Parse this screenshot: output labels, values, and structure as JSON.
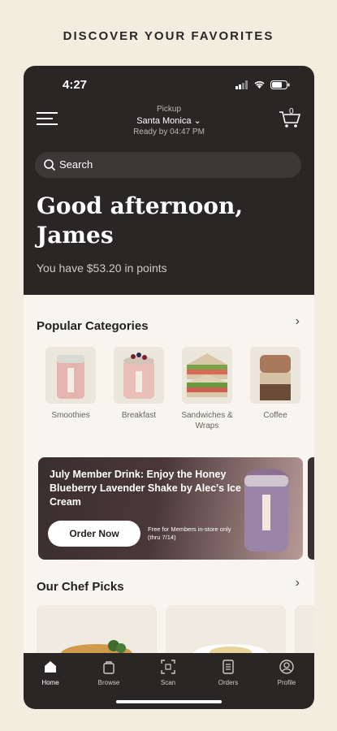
{
  "headline": "DISCOVER YOUR FAVORITES",
  "status": {
    "time": "4:27"
  },
  "pickup": {
    "label": "Pickup",
    "location": "Santa Monica",
    "ready": "Ready by 04:47 PM"
  },
  "cart": {
    "count": "0"
  },
  "search": {
    "placeholder": "Search"
  },
  "greeting": {
    "line1": "Good afternoon,",
    "line2": "James"
  },
  "points": "You have $53.20 in points",
  "popular": {
    "title": "Popular Categories",
    "categories": [
      {
        "label": "Smoothies",
        "icon": "smoothie-image"
      },
      {
        "label": "Breakfast",
        "icon": "breakfast-image"
      },
      {
        "label": "Sandwiches & Wraps",
        "icon": "sandwich-image"
      },
      {
        "label": "Coffee",
        "icon": "coffee-image"
      }
    ]
  },
  "promo": {
    "title": "July Member Drink: Enjoy the Honey Blueberry Lavender Shake by Alec's Ice Cream",
    "button": "Order Now",
    "note": "Free for Members in-store only (thru 7/14)"
  },
  "chef": {
    "title": "Our Chef Picks"
  },
  "tabs": [
    {
      "label": "Home",
      "icon": "home-icon",
      "active": true
    },
    {
      "label": "Browse",
      "icon": "bag-icon",
      "active": false
    },
    {
      "label": "Scan",
      "icon": "scan-icon",
      "active": false
    },
    {
      "label": "Orders",
      "icon": "orders-icon",
      "active": false
    },
    {
      "label": "Profile",
      "icon": "profile-icon",
      "active": false
    }
  ],
  "colors": {
    "dark": "#2a2626",
    "background": "#f1eddf",
    "card": "#f8f5ee"
  }
}
